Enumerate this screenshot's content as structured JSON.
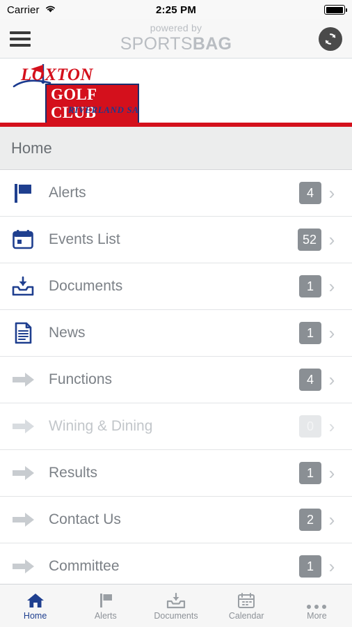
{
  "status_bar": {
    "carrier": "Carrier",
    "wifi_icon": "wifi-icon",
    "time": "2:25 PM",
    "battery_icon": "battery-full-icon"
  },
  "nav_bar": {
    "menu_icon": "hamburger-menu-icon",
    "brand_top": "powered by",
    "brand_name_part1": "SPORTS",
    "brand_name_part2": "BAG",
    "refresh_icon": "refresh-icon"
  },
  "logo_banner": {
    "line1": "LOXTON",
    "line2": "GOLF CLUB",
    "line3": "RIVERLAND SA",
    "flag_icon": "golf-flag-icon",
    "accent_color": "#d4101c",
    "accent_color_secondary": "#1a3a8f"
  },
  "page_header": {
    "title": "Home"
  },
  "menu": {
    "items": [
      {
        "label": "Alerts",
        "badge": "4",
        "icon": "flag-icon",
        "dim": false
      },
      {
        "label": "Events List",
        "badge": "52",
        "icon": "calendar-icon",
        "dim": false
      },
      {
        "label": "Documents",
        "badge": "1",
        "icon": "documents-icon",
        "dim": false
      },
      {
        "label": "News",
        "badge": "1",
        "icon": "news-icon",
        "dim": false
      },
      {
        "label": "Functions",
        "badge": "4",
        "icon": "arrow-icon",
        "dim": false
      },
      {
        "label": "Wining & Dining",
        "badge": "0",
        "icon": "arrow-icon",
        "dim": true
      },
      {
        "label": "Results",
        "badge": "1",
        "icon": "arrow-icon",
        "dim": false
      },
      {
        "label": "Contact Us",
        "badge": "2",
        "icon": "arrow-icon",
        "dim": false
      },
      {
        "label": "Committee",
        "badge": "1",
        "icon": "arrow-icon",
        "dim": false
      }
    ],
    "chevron_icon": "chevron-right-icon"
  },
  "tab_bar": {
    "tabs": [
      {
        "label": "Home",
        "icon": "home-icon",
        "active": true
      },
      {
        "label": "Alerts",
        "icon": "flag-icon",
        "active": false
      },
      {
        "label": "Documents",
        "icon": "documents-icon",
        "active": false
      },
      {
        "label": "Calendar",
        "icon": "calendar-icon",
        "active": false
      },
      {
        "label": "More",
        "icon": "more-dots-icon",
        "active": false
      }
    ],
    "active_color": "#1f3f8f"
  }
}
